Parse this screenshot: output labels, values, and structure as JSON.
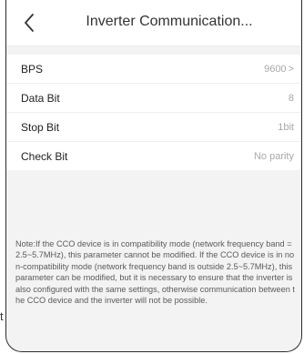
{
  "stray_text": "t",
  "header": {
    "title": "Inverter Communication...",
    "back_icon": "chevron-left-icon"
  },
  "settings": [
    {
      "label": "BPS",
      "value": "9600",
      "has_chevron": true
    },
    {
      "label": "Data Bit",
      "value": "8",
      "has_chevron": false
    },
    {
      "label": "Stop Bit",
      "value": "1bit",
      "has_chevron": false
    },
    {
      "label": "Check Bit",
      "value": "No parity",
      "has_chevron": false
    }
  ],
  "chevron_glyph": ">",
  "note": "Note:If the CCO device is in compatibility mode (network frequency band = 2.5~5.7MHz), this parameter cannot be modified. If the CCO device is in non-compatibility mode (network frequency band is outside 2.5~5.7MHz), this parameter can be modified, but it is necessary to ensure that the inverter is also configured with the same settings, otherwise communication between the CCO device and the inverter will not be possible."
}
